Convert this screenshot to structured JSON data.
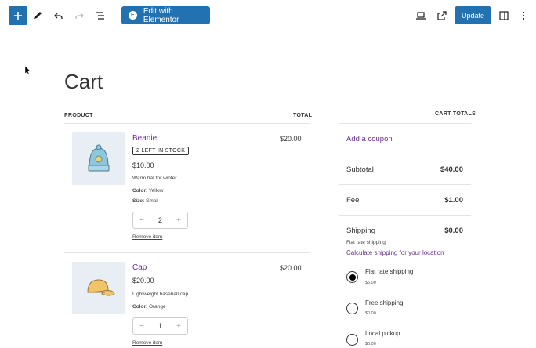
{
  "toolbar": {
    "elementor_label": "Edit with Elementor",
    "update_label": "Update"
  },
  "page": {
    "title": "Cart"
  },
  "cart": {
    "col_product": "PRODUCT",
    "col_total": "TOTAL",
    "items": [
      {
        "name": "Beanie",
        "badge": "2 LEFT IN STOCK",
        "price": "$10.00",
        "description": "Warm hat for winter",
        "color_label": "Color:",
        "color": "Yellow",
        "size_label": "Size:",
        "size": "Small",
        "quantity": "2",
        "remove_label": "Remove item",
        "total": "$20.00"
      },
      {
        "name": "Cap",
        "price": "$20.00",
        "description": "Lightweight baseball cap",
        "color_label": "Color:",
        "color": "Orange",
        "quantity": "1",
        "remove_label": "Remove item",
        "total": "$20.00"
      }
    ]
  },
  "totals": {
    "heading": "CART TOTALS",
    "coupon_label": "Add a coupon",
    "subtotal_label": "Subtotal",
    "subtotal_value": "$40.00",
    "fee_label": "Fee",
    "fee_value": "$1.00",
    "shipping_label": "Shipping",
    "shipping_value": "$0.00",
    "shipping_method": "Flat rate shipping",
    "calc_shipping_label": "Calculate shipping for your location",
    "options": [
      {
        "label": "Flat rate shipping",
        "price": "$5.00",
        "selected": true
      },
      {
        "label": "Free shipping",
        "price": "$0.00",
        "selected": false
      },
      {
        "label": "Local pickup",
        "price": "$0.00",
        "selected": false
      }
    ]
  },
  "colors": {
    "accent": "#2271b1",
    "link": "#6a2e8f"
  }
}
